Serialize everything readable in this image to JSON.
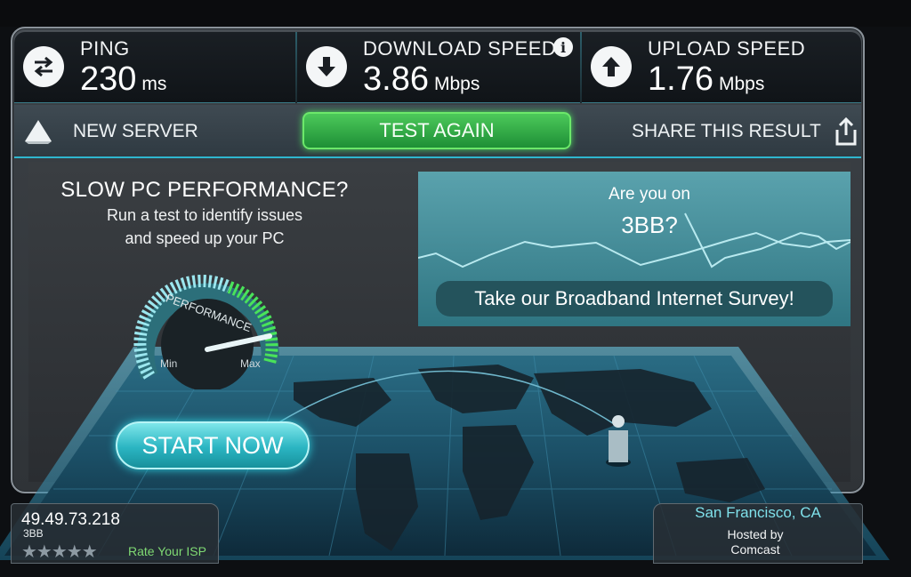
{
  "stats": {
    "ping": {
      "label": "PING",
      "value": "230",
      "unit": "ms",
      "icon": "ping-arrows-icon"
    },
    "download": {
      "label": "DOWNLOAD SPEED",
      "value": "3.86",
      "unit": "Mbps",
      "icon": "download-arrow-icon",
      "info": "i"
    },
    "upload": {
      "label": "UPLOAD SPEED",
      "value": "1.76",
      "unit": "Mbps",
      "icon": "upload-arrow-icon"
    }
  },
  "actions": {
    "new_server": "NEW SERVER",
    "test_again": "TEST AGAIN",
    "share": "SHARE THIS RESULT"
  },
  "ad": {
    "title": "SLOW PC PERFORMANCE?",
    "line1": "Run a test to identify issues",
    "line2": "and speed up your PC",
    "gauge_label": "PERFORMANCE",
    "gauge_min": "Min",
    "gauge_max": "Max",
    "button": "START NOW"
  },
  "survey": {
    "line1": "Are you on",
    "line2": "3BB?",
    "button": "Take our Broadband Internet Survey!"
  },
  "client": {
    "ip": "49.49.73.218",
    "isp": "3BB",
    "stars": "★★★★★",
    "rate_label": "Rate Your ISP",
    "rating": 0
  },
  "server": {
    "city": "San Francisco, CA",
    "hosted_label": "Hosted by",
    "host": "Comcast"
  },
  "colors": {
    "accent_green": "#4cc95a",
    "accent_cyan": "#2fb6cf",
    "rate_green": "#7fda74"
  }
}
